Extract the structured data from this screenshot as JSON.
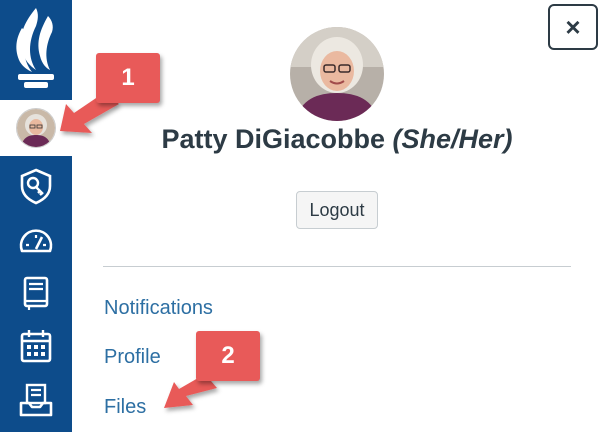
{
  "user": {
    "name": "Patty DiGiacobbe",
    "pronouns": "(She/Her)"
  },
  "tray": {
    "close_label": "×",
    "logout_label": "Logout",
    "links": [
      "Notifications",
      "Profile",
      "Files"
    ]
  },
  "callouts": {
    "one": "1",
    "two": "2"
  },
  "icons": {
    "logo": "institution-logo-icon",
    "account": "avatar",
    "admin": "shield-key-icon",
    "dashboard": "speedometer-icon",
    "courses": "book-icon",
    "calendar": "calendar-icon",
    "inbox": "inbox-icon"
  },
  "colors": {
    "sidebar": "#0d4c8b",
    "link": "#2d6fa3",
    "callout": "#e85a59",
    "text": "#2d3b45"
  }
}
